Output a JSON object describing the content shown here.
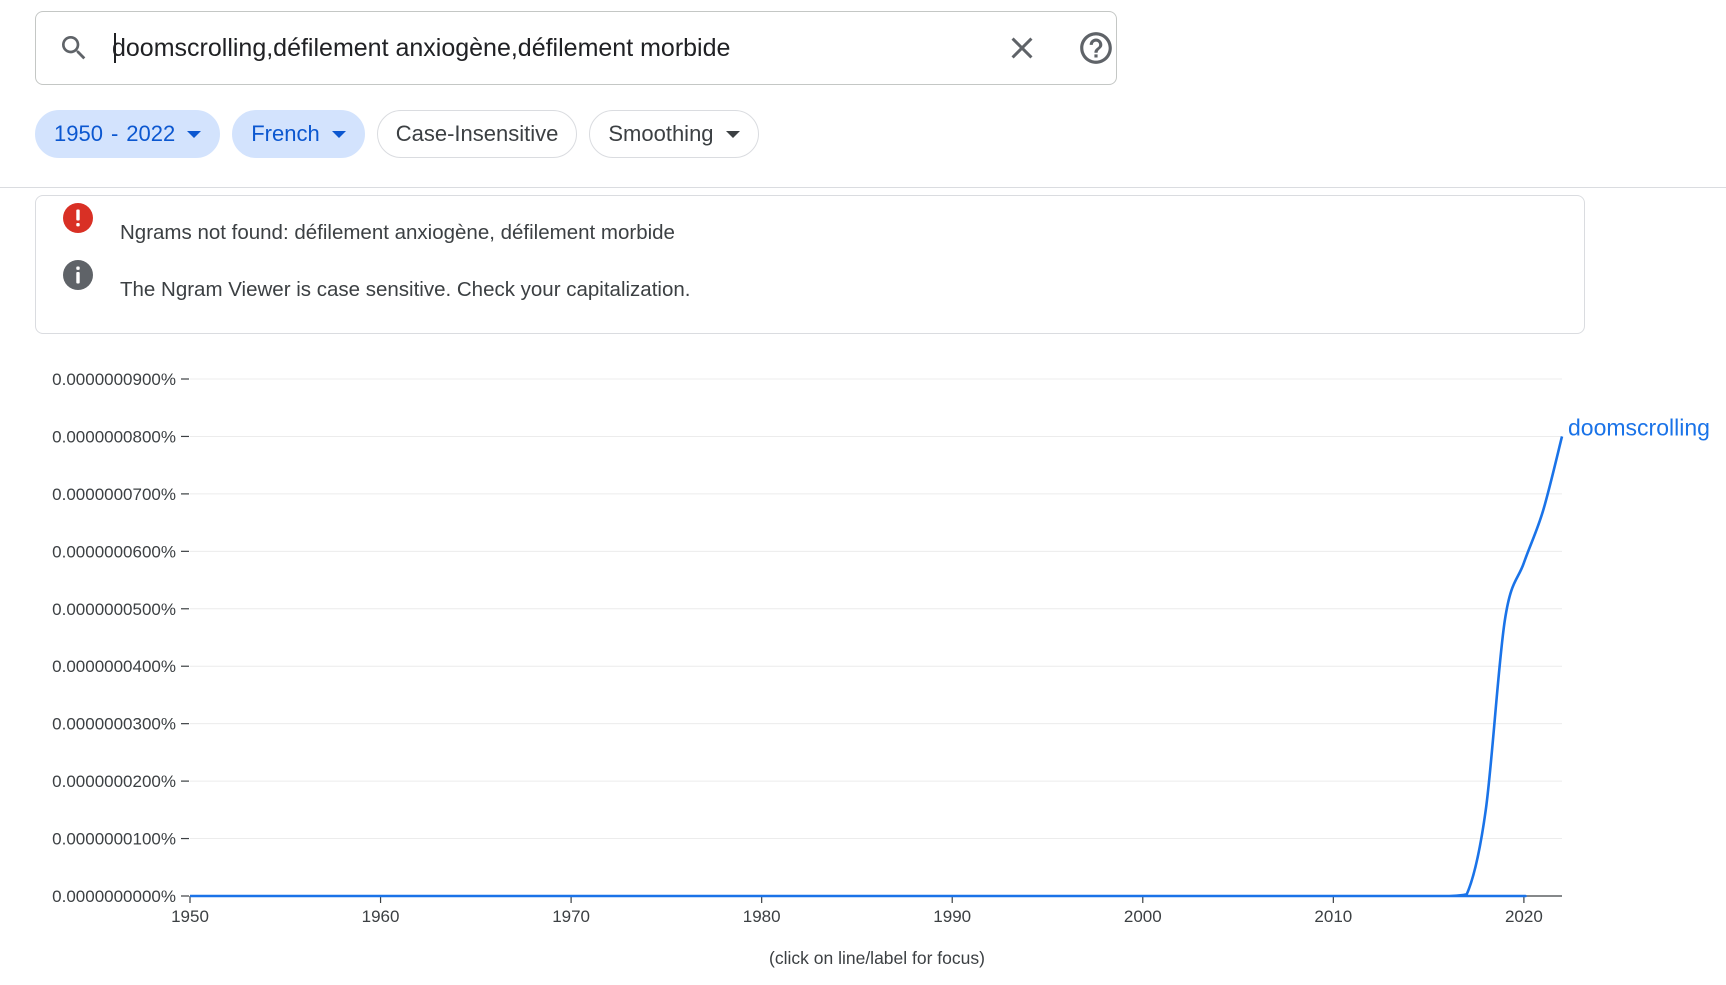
{
  "search": {
    "query": "doomscrolling,défilement anxiogène,défilement morbide"
  },
  "chips": {
    "year_start": "1950",
    "year_sep": "-",
    "year_end": "2022",
    "language": "French",
    "case": "Case-Insensitive",
    "smoothing": "Smoothing"
  },
  "messages": {
    "error": "Ngrams not found: défilement anxiogène, défilement morbide",
    "info": "The Ngram Viewer is case sensitive. Check your capitalization."
  },
  "colors": {
    "accent": "#1a73e8",
    "chip_bg": "#d3e3fd",
    "chip_text": "#0b57d0",
    "error": "#d93025",
    "info": "#5f6368"
  },
  "icons": {
    "search": "search-icon",
    "clear": "close-icon",
    "help": "help-icon",
    "error": "error-icon",
    "info": "info-icon"
  },
  "chart_data": {
    "type": "line",
    "x_range": [
      1950,
      2022
    ],
    "ylim": [
      0,
      9e-08
    ],
    "y_ticks": [
      "0.0000000000%",
      "0.0000000100%",
      "0.0000000200%",
      "0.0000000300%",
      "0.0000000400%",
      "0.0000000500%",
      "0.0000000600%",
      "0.0000000700%",
      "0.0000000800%",
      "0.0000000900%"
    ],
    "y_tick_values": [
      0,
      1e-08,
      2e-08,
      3e-08,
      4e-08,
      5e-08,
      6e-08,
      7e-08,
      8e-08,
      9e-08
    ],
    "x_ticks": [
      "1950",
      "1960",
      "1970",
      "1980",
      "1990",
      "2000",
      "2010",
      "2020"
    ],
    "x_tick_values": [
      1950,
      1960,
      1970,
      1980,
      1990,
      2000,
      2010,
      2020
    ],
    "grid": true,
    "series": [
      {
        "name": "doomscrolling",
        "color": "#1a73e8",
        "x": [
          1950,
          2015,
          2016,
          2017,
          2018,
          2019,
          2020,
          2021,
          2022
        ],
        "y": [
          0,
          0,
          0,
          3e-10,
          1.5e-08,
          4.8e-08,
          5.8e-08,
          6.7e-08,
          8e-08
        ]
      }
    ],
    "footnote": "(click on line/label for focus)"
  }
}
